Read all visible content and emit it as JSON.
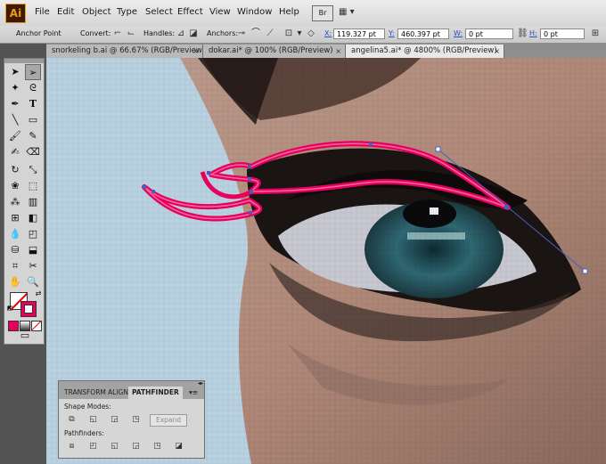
{
  "app": {
    "logo": "Ai"
  },
  "menu": [
    "File",
    "Edit",
    "Object",
    "Type",
    "Select",
    "Effect",
    "View",
    "Window",
    "Help"
  ],
  "menubar_extras": {
    "bridge": "Br",
    "workspace": "▦ ▾"
  },
  "control": {
    "label": "Anchor Point",
    "convert_label": "Convert:",
    "handles_label": "Handles:",
    "anchors_label": "Anchors:",
    "x_label": "X:",
    "x_value": "119.327 pt",
    "y_label": "Y:",
    "y_value": "460.397 pt",
    "w_label": "W:",
    "w_value": "0 pt",
    "h_label": "H:",
    "h_value": "0 pt"
  },
  "tabs": [
    {
      "label": "snorkeling b.ai @ 66.67% (RGB/Preview)",
      "active": false
    },
    {
      "label": "dokar.ai* @ 100% (RGB/Preview)",
      "active": false
    },
    {
      "label": "angelina5.ai* @ 4800% (RGB/Preview)",
      "active": true
    }
  ],
  "tab_close": "×",
  "panel": {
    "tabs": [
      "TRANSFORM",
      "ALIGN",
      "PATHFINDER"
    ],
    "menu_icon": "▾≡",
    "shape_modes_label": "Shape Modes:",
    "expand_label": "Expand",
    "pathfinders_label": "Pathfinders:"
  },
  "colors": {
    "path_stroke": "#e8005c",
    "path_highlight": "#f06aa0",
    "selection": "#4a5dbf",
    "accent": "#f7941d"
  }
}
